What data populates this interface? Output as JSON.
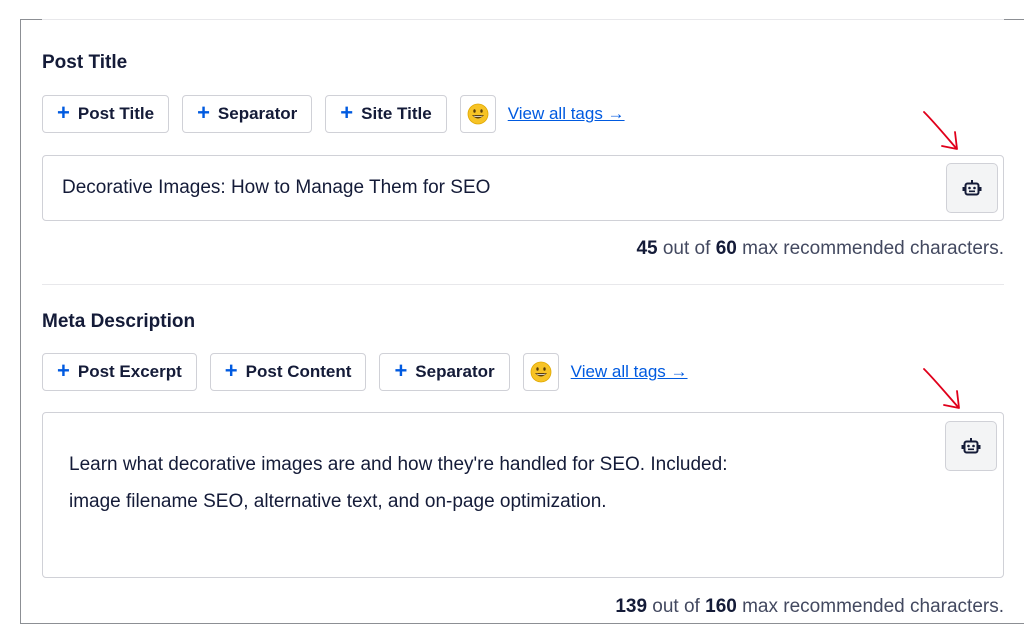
{
  "post_title": {
    "heading": "Post Title",
    "tags": [
      {
        "label": "Post Title"
      },
      {
        "label": "Separator"
      },
      {
        "label": "Site Title"
      }
    ],
    "view_all": "View all tags →",
    "value": "Decorative Images: How to Manage Them for SEO",
    "counter": {
      "count": "45",
      "mid": " out of ",
      "max": "60",
      "suffix": " max recommended characters."
    }
  },
  "meta_description": {
    "heading": "Meta Description",
    "tags": [
      {
        "label": "Post Excerpt"
      },
      {
        "label": "Post Content"
      },
      {
        "label": "Separator"
      }
    ],
    "view_all": "View all tags →",
    "value_line1": "Learn what decorative images are and how they're handled for SEO. Included:",
    "value_line2": "image filename SEO, alternative text, and on-page optimization.",
    "counter": {
      "count": "139",
      "mid": " out of ",
      "max": "160",
      "suffix": " max recommended characters."
    }
  },
  "icons": {
    "plus": "plus-icon",
    "emoji": "smiley-emoji-icon",
    "ai": "robot-icon",
    "annotation": "red-arrow-icon"
  },
  "colors": {
    "accent": "#005ae0",
    "text": "#141b38",
    "border": "#d0d1d7",
    "arrow": "#e0001b"
  }
}
